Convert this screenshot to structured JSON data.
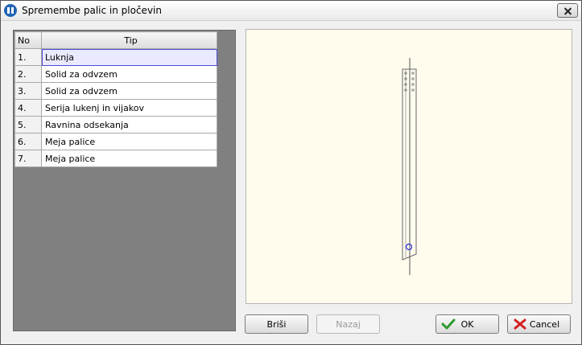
{
  "window": {
    "title": "Spremembe palic in pločevin"
  },
  "table": {
    "headers": {
      "num": "No",
      "tip": "Tip"
    },
    "rows": [
      {
        "num": "1.",
        "tip": "Luknja"
      },
      {
        "num": "2.",
        "tip": "Solid za odvzem"
      },
      {
        "num": "3.",
        "tip": "Solid za odvzem"
      },
      {
        "num": "4.",
        "tip": "Serija lukenj in vijakov"
      },
      {
        "num": "5.",
        "tip": "Ravnina odsekanja"
      },
      {
        "num": "6.",
        "tip": "Meja palice"
      },
      {
        "num": "7.",
        "tip": "Meja palice"
      }
    ],
    "selected_index": 0
  },
  "buttons": {
    "delete": "Briši",
    "back": "Nazaj",
    "ok": "OK",
    "cancel": "Cancel"
  },
  "icons": {
    "ok": "checkmark-icon",
    "cancel": "red-x-icon",
    "app": "app-logo-icon",
    "close": "close-icon"
  }
}
